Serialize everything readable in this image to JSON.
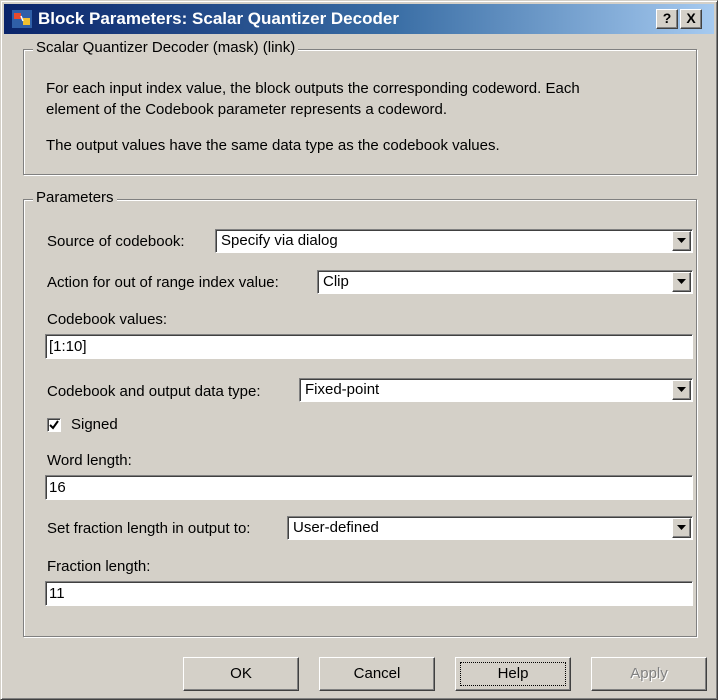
{
  "window": {
    "title": "Block Parameters: Scalar Quantizer Decoder",
    "help_glyph": "?",
    "close_glyph": "X",
    "icon": "simulink-block-icon"
  },
  "description": {
    "legend": "Scalar Quantizer Decoder (mask) (link)",
    "line1": "For each input index value, the block outputs the corresponding codeword. Each",
    "line2": "element of the Codebook parameter represents a codeword.",
    "line3": "The output values have the same data type as the codebook values."
  },
  "parameters": {
    "legend": "Parameters",
    "source_of_codebook": {
      "label": "Source of codebook:",
      "value": "Specify via dialog"
    },
    "out_of_range_action": {
      "label": "Action for out of range index value:",
      "value": "Clip"
    },
    "codebook_values": {
      "label": "Codebook values:",
      "value": "[1:10]"
    },
    "data_type": {
      "label": "Codebook and output data type:",
      "value": "Fixed-point"
    },
    "signed": {
      "label": "Signed",
      "checked": true
    },
    "word_length": {
      "label": "Word length:",
      "value": "16"
    },
    "fraction_mode": {
      "label": "Set fraction length in output to:",
      "value": "User-defined"
    },
    "fraction_length": {
      "label": "Fraction length:",
      "value": "11"
    }
  },
  "buttons": {
    "ok": "OK",
    "cancel": "Cancel",
    "help": "Help",
    "apply": "Apply"
  }
}
